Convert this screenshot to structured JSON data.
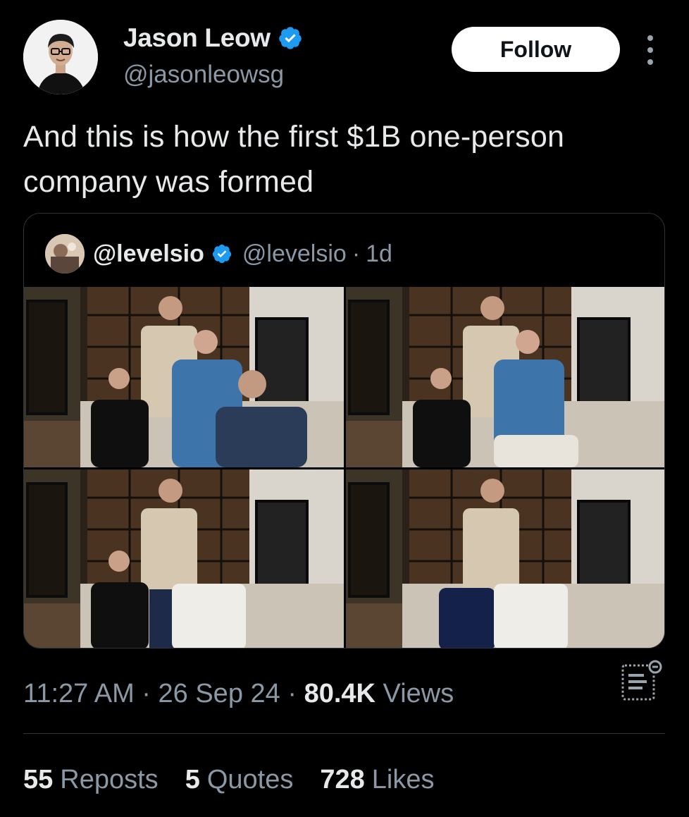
{
  "tweet": {
    "author": {
      "name": "Jason Leow",
      "handle": "@jasonleowsg",
      "verified": true
    },
    "follow_label": "Follow",
    "text": "And this is how the first $1B one-person\ncompany was formed",
    "quoted": {
      "name": "@levelsio",
      "handle": "@levelsio",
      "separator": "·",
      "time": "1d",
      "verified": true
    },
    "meta": {
      "time": "11:27 AM",
      "dot1": "·",
      "date": "26 Sep 24",
      "dot2": "·",
      "views_count": "80.4K",
      "views_label": "Views"
    },
    "stats": {
      "reposts_count": "55",
      "reposts_label": "Reposts",
      "quotes_count": "5",
      "quotes_label": "Quotes",
      "likes_count": "728",
      "likes_label": "Likes"
    }
  },
  "colors": {
    "background": "#000000",
    "text_primary": "#e7e9ea",
    "text_secondary": "#8b98a5",
    "verified_blue": "#1d9bf0",
    "divider": "#2f3336"
  }
}
